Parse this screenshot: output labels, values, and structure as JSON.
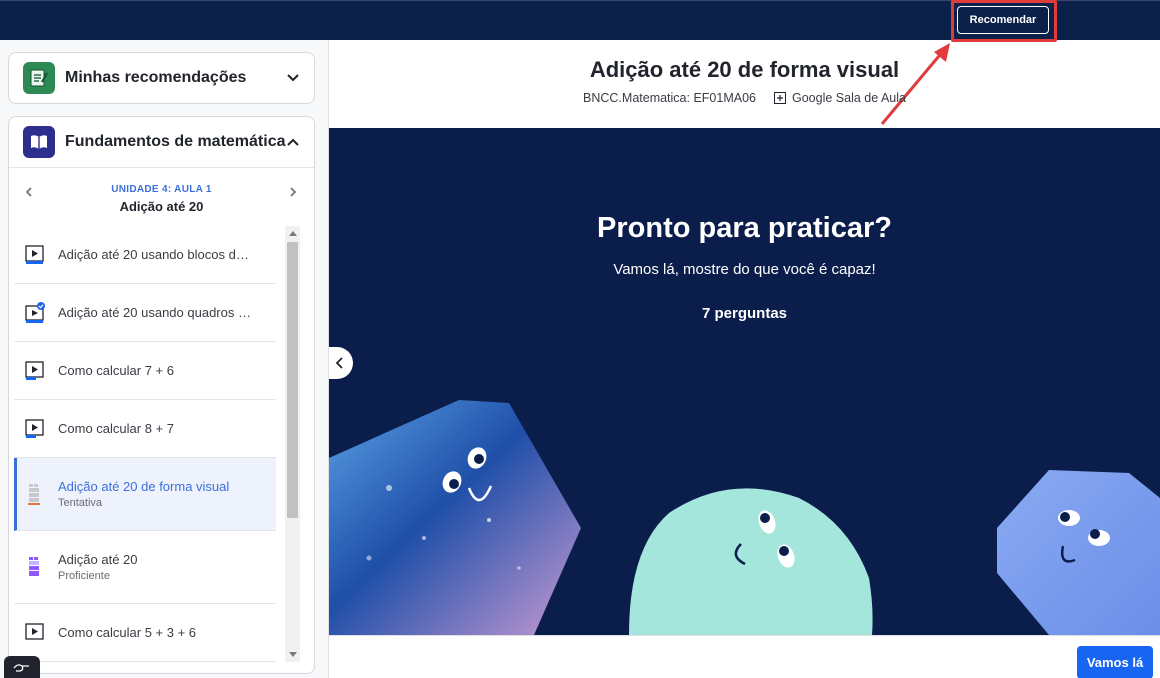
{
  "topbar": {
    "recommend_label": "Recomendar"
  },
  "sidebar": {
    "my_recs": {
      "title": "Minhas recomendações"
    },
    "course": {
      "title": "Fundamentos de matemática",
      "unit_label": "UNIDADE 4: AULA 1",
      "unit_title": "Adição até 20"
    },
    "items": [
      {
        "title": "Adição até 20 usando blocos de ...",
        "subtitle": "",
        "type": "video"
      },
      {
        "title": "Adição até 20 usando quadros d...",
        "subtitle": "",
        "type": "video-done"
      },
      {
        "title": "Como calcular 7 + 6",
        "subtitle": "",
        "type": "video"
      },
      {
        "title": "Como calcular 8 + 7",
        "subtitle": "",
        "type": "video"
      },
      {
        "title": "Adição até 20 de forma visual",
        "subtitle": "Tentativa",
        "type": "exercise-attempted"
      },
      {
        "title": "Adição até 20",
        "subtitle": "Proficiente",
        "type": "exercise-proficient"
      },
      {
        "title": "Como calcular 5 + 3 + 6",
        "subtitle": "",
        "type": "video"
      }
    ]
  },
  "main": {
    "title": "Adição até 20 de forma visual",
    "standard": "BNCC.Matematica: EF01MA06",
    "classroom": "Google Sala de Aula",
    "hero_title": "Pronto para praticar?",
    "hero_subtitle": "Vamos lá, mostre do que você é capaz!",
    "question_count": "7 perguntas",
    "start_label": "Vamos lá"
  },
  "colors": {
    "topbar": "#0b2149",
    "hero": "#0b1e4b",
    "accent": "#1865f2",
    "highlight": "#e13b3b"
  }
}
